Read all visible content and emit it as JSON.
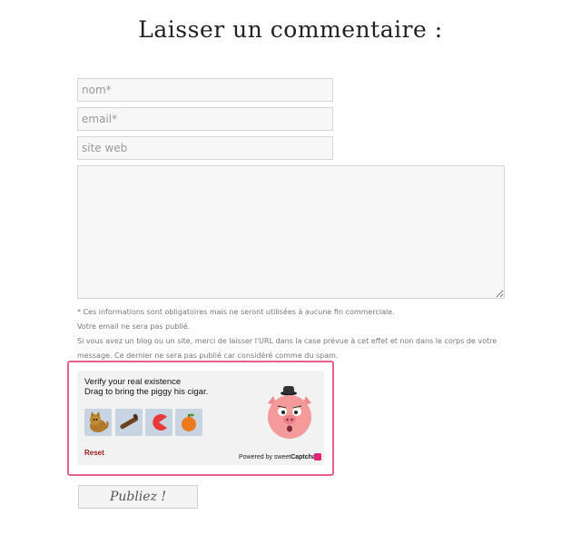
{
  "form": {
    "title": "Laisser un commentaire :",
    "name_placeholder": "nom*",
    "email_placeholder": "email*",
    "website_placeholder": "site web",
    "comment_value": "",
    "notes": [
      "* Ces informations sont obligatoires mais ne seront utilisées à aucune fin commerciale.",
      "Votre email ne sera pas publié.",
      "Si vous avez un blog ou un site, merci de laisser l'URL dans la case prévue à cet effet et non dans le corps de votre message. Ce dernier ne sera pas publié car considéré comme du spam."
    ],
    "submit_label": "Publiez !"
  },
  "captcha": {
    "line1": "Verify your real existence",
    "line2": "Drag to bring the piggy his cigar.",
    "items": [
      "cat-icon",
      "cigar-icon",
      "pacman-icon",
      "orange-icon"
    ],
    "reset_label": "Reset",
    "powered_prefix": "Powered by sweet",
    "powered_brand": "Captcha",
    "accent_color": "#e8608f",
    "brand_color": "#e0247a"
  }
}
